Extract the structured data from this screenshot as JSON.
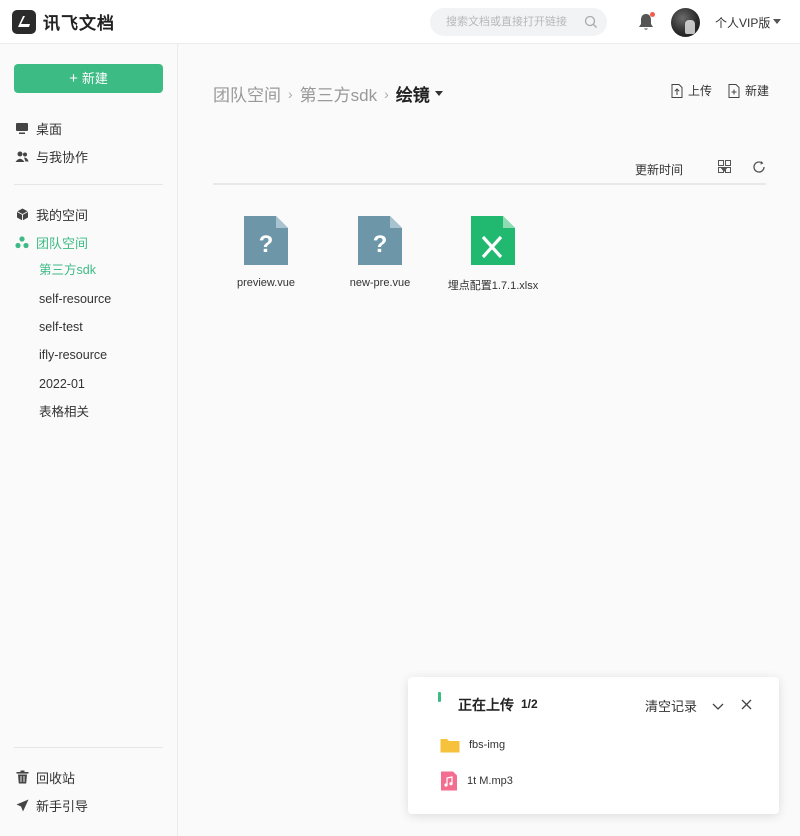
{
  "app": {
    "name": "讯飞文档"
  },
  "header": {
    "search_placeholder": "搜索文档或直接打开链接",
    "user_label": "个人VIP版"
  },
  "sidebar": {
    "new_label": "新建",
    "nav": [
      {
        "label": "桌面",
        "icon": "monitor-icon"
      },
      {
        "label": "与我协作",
        "icon": "people-icon"
      },
      {
        "label": "我的空间",
        "icon": "cube-icon"
      },
      {
        "label": "团队空间",
        "icon": "team-icon",
        "active": true
      }
    ],
    "team_items": [
      {
        "label": "第三方sdk",
        "active": true
      },
      {
        "label": "self-resource"
      },
      {
        "label": "self-test"
      },
      {
        "label": "ifly-resource"
      },
      {
        "label": "2022-01"
      },
      {
        "label": "表格相关"
      }
    ],
    "bottom": [
      {
        "label": "回收站",
        "icon": "trash-icon"
      },
      {
        "label": "新手引导",
        "icon": "send-icon"
      }
    ]
  },
  "main": {
    "breadcrumb": [
      "团队空间",
      "第三方sdk",
      "绘镜"
    ],
    "actions": {
      "upload_label": "上传",
      "new_label": "新建"
    },
    "sort_label": "更新时间",
    "files": [
      {
        "name": "preview.vue",
        "type": "unknown"
      },
      {
        "name": "new-pre.vue",
        "type": "unknown"
      },
      {
        "name": "埋点配置1.7.1.xlsx",
        "type": "excel"
      }
    ]
  },
  "upload_panel": {
    "title": "正在上传",
    "count": "1/2",
    "clear_label": "清空记录",
    "items": [
      {
        "name": "fbs-img",
        "type": "folder"
      },
      {
        "name": "1t M.mp3",
        "type": "audio"
      }
    ]
  },
  "colors": {
    "accent": "#3dbb85",
    "unknown_file": "#6d97a8",
    "excel": "#21b96f",
    "folder": "#f7c23b",
    "audio": "#f26d8f"
  }
}
